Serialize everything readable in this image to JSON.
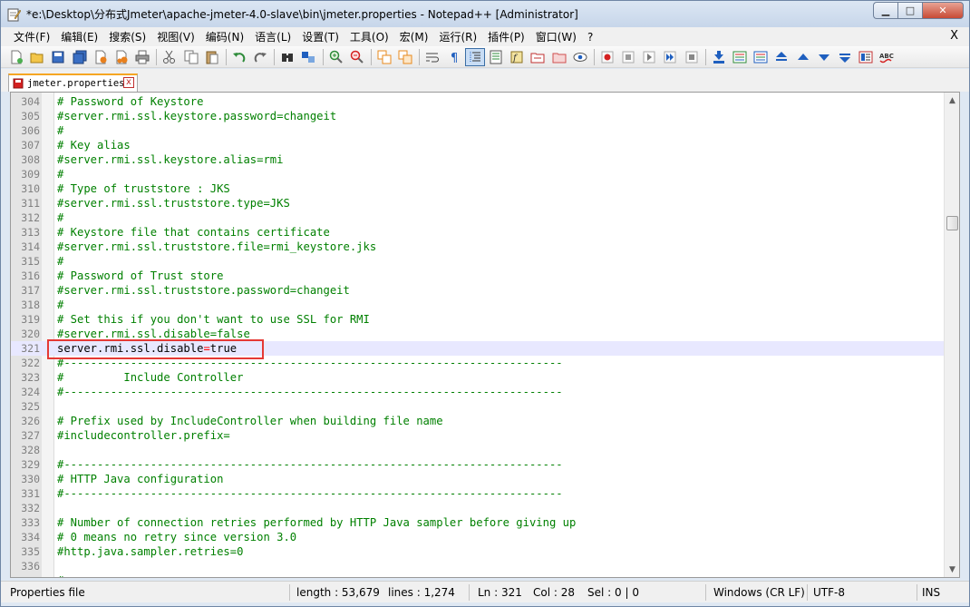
{
  "window": {
    "title": "*e:\\Desktop\\分布式Jmeter\\apache-jmeter-4.0-slave\\bin\\jmeter.properties - Notepad++ [Administrator]",
    "min_label": "▁",
    "max_label": "□",
    "close_label": "✕"
  },
  "menu": {
    "items": [
      "文件(F)",
      "编辑(E)",
      "搜索(S)",
      "视图(V)",
      "编码(N)",
      "语言(L)",
      "设置(T)",
      "工具(O)",
      "宏(M)",
      "运行(R)",
      "插件(P)",
      "窗口(W)",
      "?"
    ],
    "close_doc": "X"
  },
  "toolbar": {
    "buttons": [
      "new",
      "open",
      "save",
      "save-all",
      "close",
      "close-all",
      "print",
      "cut",
      "copy",
      "paste",
      "undo",
      "redo",
      "find",
      "replace",
      "zoom-in",
      "zoom-out",
      "sync-v",
      "sync-h",
      "word-wrap",
      "show-all-chars",
      "indent-guide",
      "doc-map",
      "function-list",
      "folder-workspace",
      "monitor",
      "record-macro",
      "stop-macro",
      "play-macro",
      "run-macro-multiple",
      "save-macro",
      "add-bookmark",
      "compare",
      "compare-clear",
      "previous-diff",
      "next-diff",
      "last-diff",
      "navigation",
      "spell-check"
    ],
    "active": "word-wrap",
    "colors": {
      "blue": "#1f5fbf",
      "green": "#2e8b3a",
      "red": "#d42020",
      "yellow": "#e8b828",
      "orange": "#e88a1e"
    }
  },
  "tab": {
    "label": "jmeter.properties",
    "modified_color": "#d42020",
    "close_label": "x"
  },
  "editor": {
    "lines": [
      {
        "no": "304",
        "text": "# Password of Keystore"
      },
      {
        "no": "305",
        "text": "#server.rmi.ssl.keystore.password=changeit"
      },
      {
        "no": "306",
        "text": "#"
      },
      {
        "no": "307",
        "text": "# Key alias"
      },
      {
        "no": "308",
        "text": "#server.rmi.ssl.keystore.alias=rmi"
      },
      {
        "no": "309",
        "text": "#"
      },
      {
        "no": "310",
        "text": "# Type of truststore : JKS"
      },
      {
        "no": "311",
        "text": "#server.rmi.ssl.truststore.type=JKS"
      },
      {
        "no": "312",
        "text": "#"
      },
      {
        "no": "313",
        "text": "# Keystore file that contains certificate"
      },
      {
        "no": "314",
        "text": "#server.rmi.ssl.truststore.file=rmi_keystore.jks"
      },
      {
        "no": "315",
        "text": "#"
      },
      {
        "no": "316",
        "text": "# Password of Trust store"
      },
      {
        "no": "317",
        "text": "#server.rmi.ssl.truststore.password=changeit"
      },
      {
        "no": "318",
        "text": "#"
      },
      {
        "no": "319",
        "text": "# Set this if you don't want to use SSL for RMI"
      },
      {
        "no": "320",
        "text": "#server.rmi.ssl.disable=false"
      },
      {
        "no": "321",
        "key": "server.rmi.ssl.disable",
        "eq": "=",
        "value": "true",
        "current": true
      },
      {
        "no": "322",
        "text": "#---------------------------------------------------------------------------"
      },
      {
        "no": "323",
        "text": "#         Include Controller"
      },
      {
        "no": "324",
        "text": "#---------------------------------------------------------------------------"
      },
      {
        "no": "325",
        "text": ""
      },
      {
        "no": "326",
        "text": "# Prefix used by IncludeController when building file name"
      },
      {
        "no": "327",
        "text": "#includecontroller.prefix="
      },
      {
        "no": "328",
        "text": ""
      },
      {
        "no": "329",
        "text": "#---------------------------------------------------------------------------"
      },
      {
        "no": "330",
        "text": "# HTTP Java configuration"
      },
      {
        "no": "331",
        "text": "#---------------------------------------------------------------------------"
      },
      {
        "no": "332",
        "text": ""
      },
      {
        "no": "333",
        "text": "# Number of connection retries performed by HTTP Java sampler before giving up"
      },
      {
        "no": "334",
        "text": "# 0 means no retry since version 3.0"
      },
      {
        "no": "335",
        "text": "#http.java.sampler.retries=0"
      },
      {
        "no": "336",
        "text": ""
      },
      {
        "no": "",
        "text": "#"
      }
    ],
    "highlight_color": "#e53935",
    "comment_color": "#008000",
    "operator_color": "#ff0000"
  },
  "status": {
    "file_type": "Properties file",
    "length": "length : 53,679",
    "lines": "lines : 1,274",
    "ln": "Ln : 321",
    "col": "Col : 28",
    "sel": "Sel : 0 | 0",
    "eol": "Windows (CR LF)",
    "encoding": "UTF-8",
    "mode": "INS"
  }
}
